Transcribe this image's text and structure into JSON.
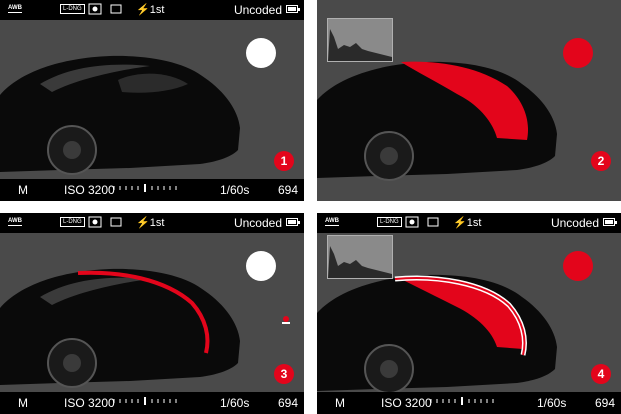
{
  "panels": [
    {
      "number": "1",
      "circle_color": "#ffffff",
      "topbar": {
        "awb": "AWB",
        "cd": "L-DNG",
        "flash": "⚡1st",
        "status": "Uncoded"
      },
      "bottombar": {
        "mode": "M",
        "iso": "ISO 3200",
        "shutter": "1/60s",
        "shots": "694"
      },
      "histogram": false,
      "highlight": "none",
      "marker": false
    },
    {
      "number": "2",
      "circle_color": "#e3051b",
      "topbar": null,
      "bottombar": null,
      "histogram": true,
      "highlight": "fill",
      "marker": false
    },
    {
      "number": "3",
      "circle_color": "#ffffff",
      "topbar": {
        "awb": "AWB",
        "cd": "L-DNG",
        "flash": "⚡1st",
        "status": "Uncoded"
      },
      "bottombar": {
        "mode": "M",
        "iso": "ISO 3200",
        "shutter": "1/60s",
        "shots": "694"
      },
      "histogram": false,
      "highlight": "edge",
      "marker": true
    },
    {
      "number": "4",
      "circle_color": "#e3051b",
      "topbar": {
        "awb": "AWB",
        "cd": "L-DNG",
        "flash": "⚡1st",
        "status": "Uncoded"
      },
      "bottombar": {
        "mode": "M",
        "iso": "ISO 3200",
        "shutter": "1/60s",
        "shots": "694"
      },
      "histogram": true,
      "highlight": "fill-outline",
      "marker": false
    }
  ],
  "colors": {
    "accent": "#e3051b",
    "screen": "#4a4a4a",
    "bars": "#000000"
  }
}
